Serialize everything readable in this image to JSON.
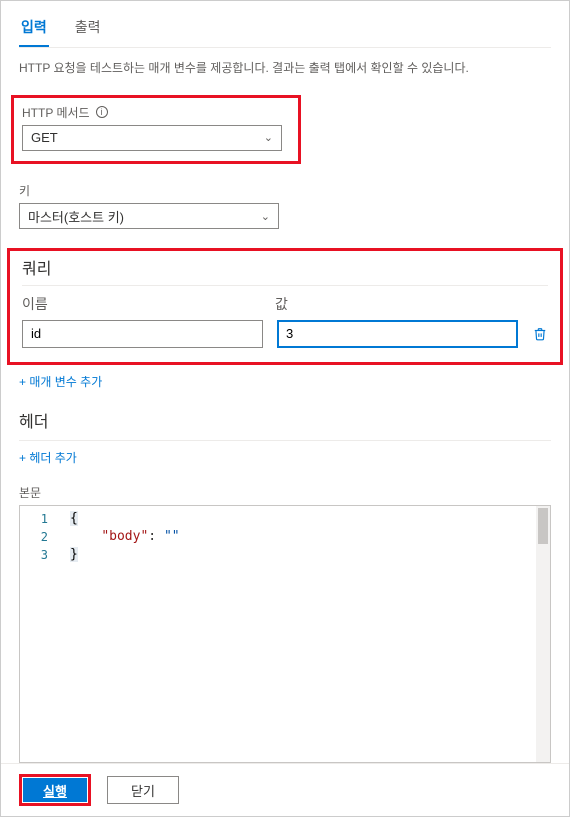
{
  "tabs": {
    "input": "입력",
    "output": "출력"
  },
  "description": "HTTP 요청을 테스트하는 매개 변수를 제공합니다. 결과는 출력 탭에서 확인할 수 있습니다.",
  "httpMethod": {
    "label": "HTTP 메서드",
    "value": "GET"
  },
  "key": {
    "label": "키",
    "value": "마스터(호스트 키)"
  },
  "query": {
    "title": "쿼리",
    "nameLabel": "이름",
    "valueLabel": "값",
    "rows": [
      {
        "name": "id",
        "value": "3"
      }
    ],
    "addLabel": "+ 매개 변수 추가"
  },
  "headers": {
    "title": "헤더",
    "addLabel": "+ 헤더 추가"
  },
  "body": {
    "label": "본문",
    "lines": [
      "1",
      "2",
      "3"
    ],
    "code": {
      "bodyKey": "\"body\"",
      "bodyVal": "\"\""
    }
  },
  "footer": {
    "run": "실행",
    "close": "닫기"
  }
}
